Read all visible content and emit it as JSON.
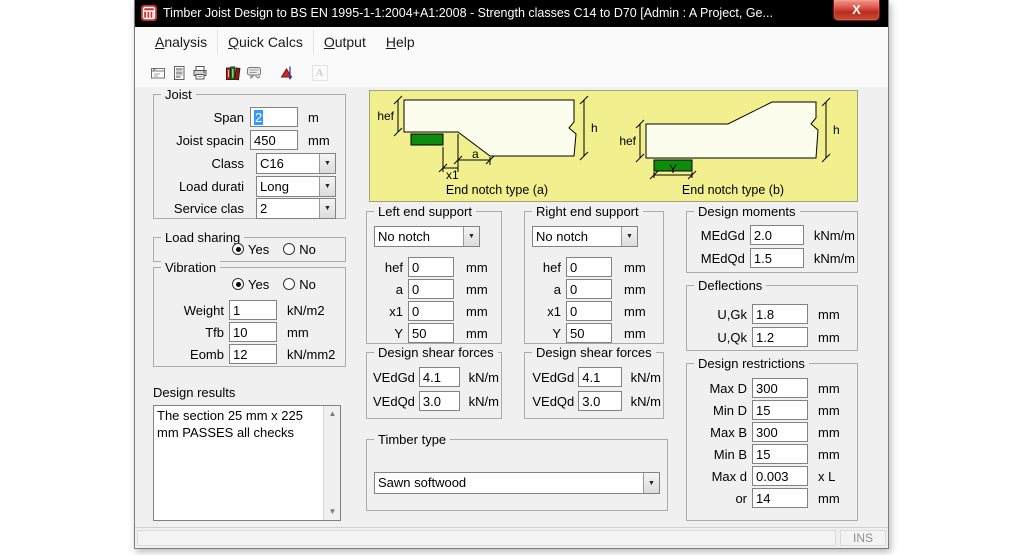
{
  "window": {
    "title": "Timber Joist Design to BS EN 1995-1-1:2004+A1:2008 - Strength classes C14 to D70 [Admin : A Project, Ge...",
    "close_glyph": "X"
  },
  "menu": {
    "items": [
      "Analysis",
      "Quick Calcs",
      "Output",
      "Help"
    ]
  },
  "toolbar": {
    "icons": [
      "form-icon",
      "report-icon",
      "print-icon",
      "library-icon",
      "feedback-icon",
      "plot-icon",
      "font-icon"
    ],
    "font_glyph": "A",
    "scroll_up_glyph": "▲",
    "scroll_down_glyph": "▼",
    "combo_arrow_glyph": "▼"
  },
  "groups": {
    "joist": {
      "title": "Joist",
      "rows": [
        {
          "label": "Span",
          "value": "2",
          "unit": "m"
        },
        {
          "label": "Joist spacin",
          "value": "450",
          "unit": "mm"
        },
        {
          "label": "Class",
          "value": "C16"
        },
        {
          "label": "Load durati",
          "value": "Long"
        },
        {
          "label": "Service clas",
          "value": "2"
        }
      ]
    },
    "load_sharing": {
      "title": "Load sharing",
      "yes_label": "Yes",
      "no_label": "No",
      "selected": "Yes"
    },
    "vibration": {
      "title": "Vibration",
      "yes_label": "Yes",
      "no_label": "No",
      "selected": "Yes",
      "rows": [
        {
          "label": "Weight",
          "value": "1",
          "unit": "kN/m2"
        },
        {
          "label": "Tfb",
          "value": "10",
          "unit": "mm"
        },
        {
          "label": "Eomb",
          "value": "12",
          "unit": "kN/mm2"
        }
      ]
    },
    "design_results": {
      "label": "Design results",
      "text": "The section 25 mm x 225 mm PASSES all checks"
    },
    "left_end_support": {
      "title": "Left end support",
      "notch": "No notch",
      "rows": [
        {
          "label": "hef",
          "value": "0",
          "unit": "mm"
        },
        {
          "label": "a",
          "value": "0",
          "unit": "mm"
        },
        {
          "label": "x1",
          "value": "0",
          "unit": "mm"
        },
        {
          "label": "Y",
          "value": "50",
          "unit": "mm"
        }
      ]
    },
    "right_end_support": {
      "title": "Right end support",
      "notch": "No notch",
      "rows": [
        {
          "label": "hef",
          "value": "0",
          "unit": "mm"
        },
        {
          "label": "a",
          "value": "0",
          "unit": "mm"
        },
        {
          "label": "x1",
          "value": "0",
          "unit": "mm"
        },
        {
          "label": "Y",
          "value": "50",
          "unit": "mm"
        }
      ]
    },
    "shear_left": {
      "title": "Design shear forces",
      "rows": [
        {
          "label": "VEdGd",
          "value": "4.1",
          "unit": "kN/m"
        },
        {
          "label": "VEdQd",
          "value": "3.0",
          "unit": "kN/m"
        }
      ]
    },
    "shear_right": {
      "title": "Design shear forces",
      "rows": [
        {
          "label": "VEdGd",
          "value": "4.1",
          "unit": "kN/m"
        },
        {
          "label": "VEdQd",
          "value": "3.0",
          "unit": "kN/m"
        }
      ]
    },
    "design_moments": {
      "title": "Design moments",
      "rows": [
        {
          "label": "MEdGd",
          "value": "2.0",
          "unit": "kNm/m"
        },
        {
          "label": "MEdQd",
          "value": "1.5",
          "unit": "kNm/m"
        }
      ]
    },
    "deflections": {
      "title": "Deflections",
      "rows": [
        {
          "label": "U,Gk",
          "value": "1.8",
          "unit": "mm"
        },
        {
          "label": "U,Qk",
          "value": "1.2",
          "unit": "mm"
        }
      ]
    },
    "design_restrictions": {
      "title": "Design restrictions",
      "rows": [
        {
          "label": "Max D",
          "value": "300",
          "unit": "mm"
        },
        {
          "label": "Min D",
          "value": "15",
          "unit": "mm"
        },
        {
          "label": "Max B",
          "value": "300",
          "unit": "mm"
        },
        {
          "label": "Min B",
          "value": "15",
          "unit": "mm"
        },
        {
          "label": "Max d",
          "value": "0.003",
          "unit": "x L"
        },
        {
          "label": "or",
          "value": "14",
          "unit": "mm"
        }
      ]
    },
    "timber_type": {
      "title": "Timber type",
      "value": "Sawn softwood"
    }
  },
  "diagram": {
    "labels": {
      "hef": "hef",
      "h": "h",
      "x1": "x1",
      "a": "a",
      "y": "Y"
    },
    "captions": {
      "a": "End notch type (a)",
      "b": "End notch type (b)"
    }
  },
  "statusbar": {
    "ins": "INS"
  },
  "colors": {
    "titlebar": "#000000",
    "close_red": "#c23328",
    "diagram_bg": "#f2ef8e",
    "support_green": "#0e8c0e",
    "selection_blue": "#3399ff",
    "client_bg": "#f0f0f0"
  }
}
